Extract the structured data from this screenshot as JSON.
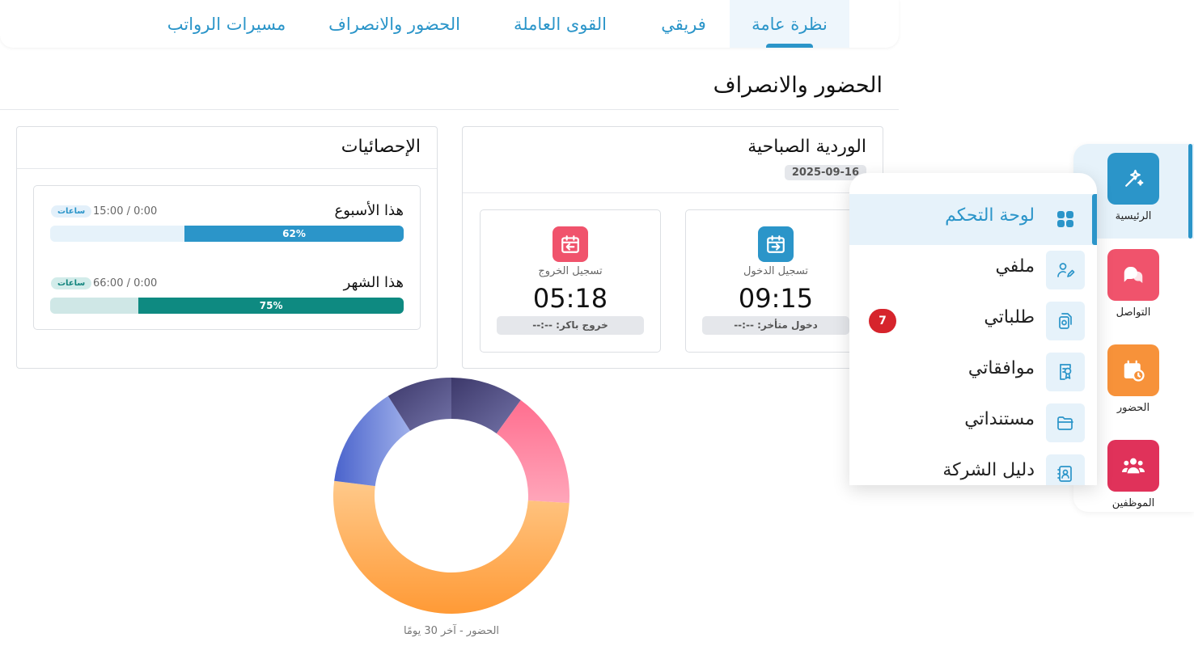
{
  "tabs": [
    {
      "label": "نظرة عامة",
      "active": true
    },
    {
      "label": "فريقي",
      "active": false
    },
    {
      "label": "القوى العاملة",
      "active": false
    },
    {
      "label": "الحضور والانصراف",
      "active": false
    },
    {
      "label": "مسيرات الرواتب",
      "active": false
    }
  ],
  "page": {
    "title": "الحضور والانصراف"
  },
  "shift": {
    "title": "الوردية الصباحية",
    "date": "2025-09-16",
    "check_in": {
      "label": "تسجيل الدخول",
      "time": "09:15",
      "status": "دخول متأخر: --:--",
      "icon": "calendar-arrow-in-icon"
    },
    "check_out": {
      "label": "تسجيل الخروج",
      "time": "05:18",
      "status": "خروج باكر: --:--",
      "icon": "calendar-arrow-out-icon"
    }
  },
  "stats": {
    "title": "الإحصائيات",
    "week": {
      "name": "هذا الأسبوع",
      "hours": "15:00 / 0:00",
      "unit": "ساعات",
      "percent_label": "62%",
      "percent": 62
    },
    "month": {
      "name": "هذا الشهر",
      "hours": "66:00 / 0:00",
      "unit": "ساعات",
      "percent_label": "75%",
      "percent": 75
    }
  },
  "donut": {
    "caption": "الحضور - آخر 30 يومًا",
    "segments_percent": [
      10,
      16,
      51,
      14,
      9
    ],
    "colors": [
      "#1e1b5a",
      "#ff7a98",
      "#ffa445",
      "#5671d0",
      "#1e1b5a"
    ]
  },
  "rail": [
    {
      "label": "الرئيسية",
      "icon": "sparkle-arrow-icon",
      "color": "#2b95c9",
      "active": true
    },
    {
      "label": "التواصل",
      "icon": "chat-bubbles-icon",
      "color": "#f0536c",
      "active": false
    },
    {
      "label": "الحضور",
      "icon": "calendar-clock-icon",
      "color": "#f7923a",
      "active": false
    },
    {
      "label": "الموظفين",
      "icon": "people-group-icon",
      "color": "#e0325a",
      "active": false
    }
  ],
  "menu": {
    "items": [
      {
        "label": "لوحة التحكم",
        "icon": "grid-icon",
        "active": true
      },
      {
        "label": "ملفي",
        "icon": "user-edit-icon",
        "active": false
      },
      {
        "label": "طلباتي",
        "icon": "document-badge-icon",
        "active": false
      },
      {
        "label": "موافقاتي",
        "icon": "approval-icon",
        "active": false
      },
      {
        "label": "مستنداتي",
        "icon": "folder-icon",
        "active": false
      },
      {
        "label": "دليل الشركة",
        "icon": "contact-book-icon",
        "active": false
      }
    ],
    "requests_badge": "7"
  }
}
